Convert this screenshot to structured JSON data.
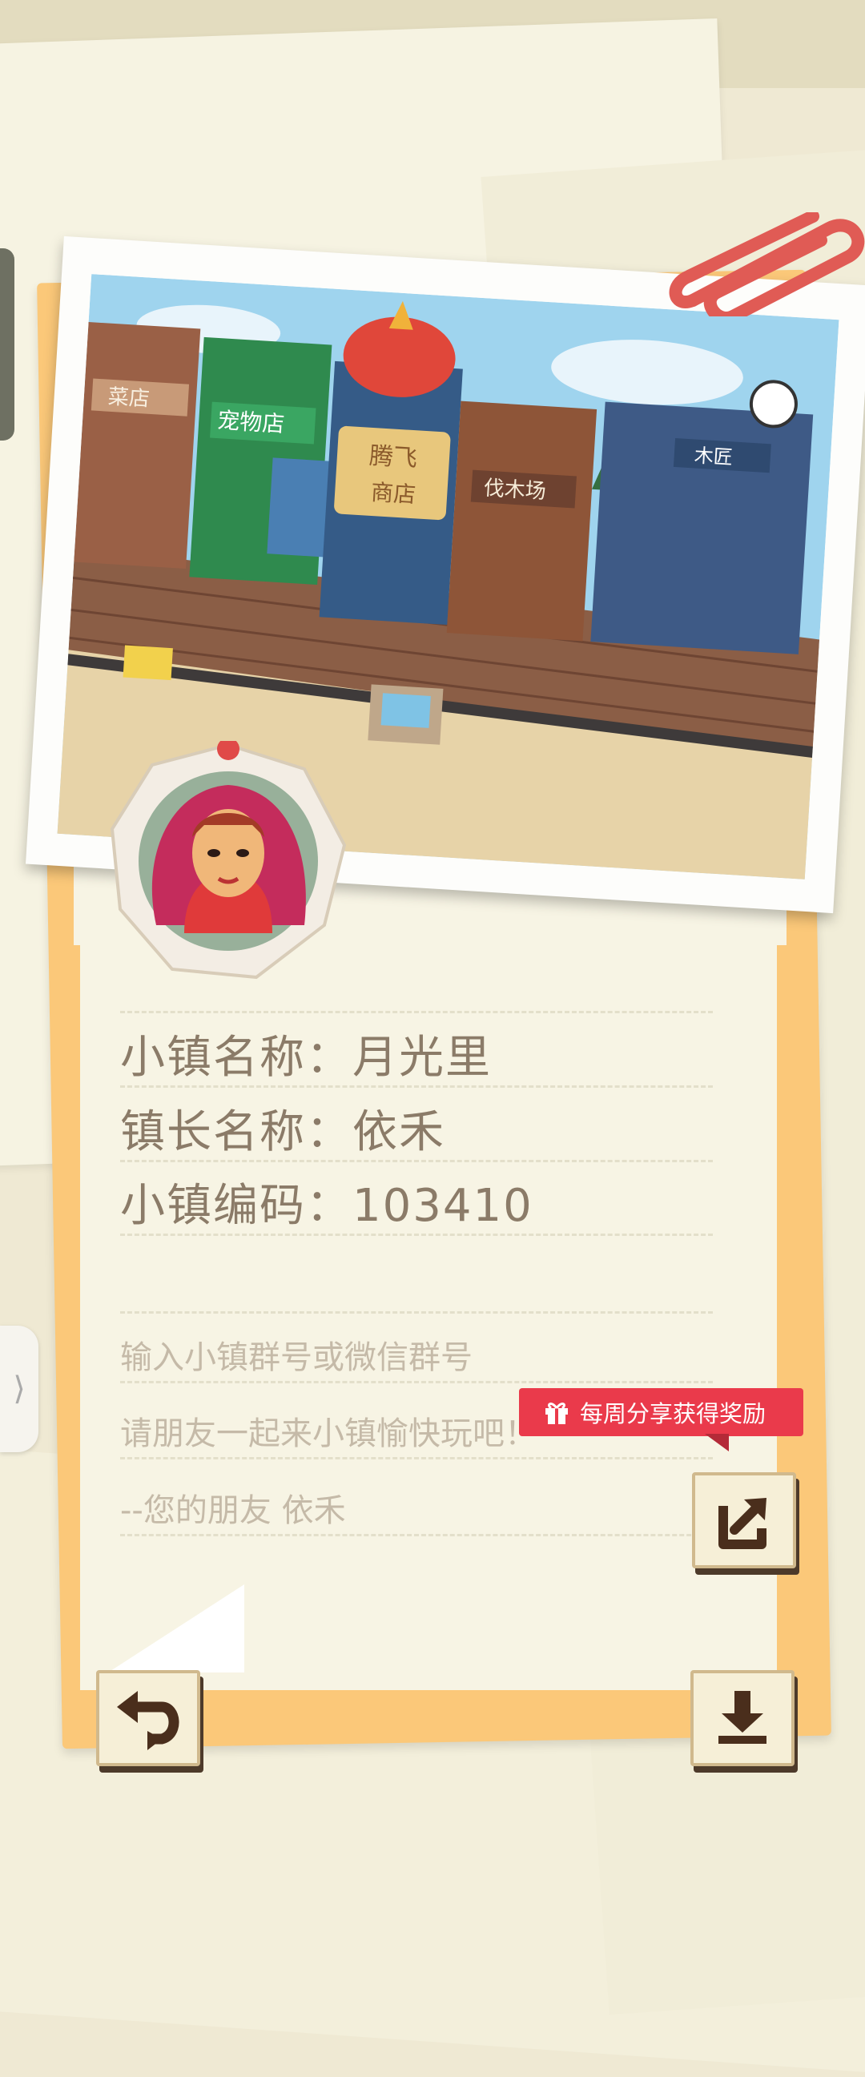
{
  "town": {
    "name_label": "小镇名称：",
    "name_value": "月光里",
    "mayor_label": "镇长名称：",
    "mayor_value": "依禾",
    "code_label": "小镇编码：",
    "code_value": "103410"
  },
  "message": {
    "line1": "输入小镇群号或微信群号",
    "line2": "请朋友一起来小镇愉快玩吧！",
    "line3": "--您的朋友  依禾"
  },
  "banner": {
    "text": "每周分享获得奖励",
    "icon": "gift-icon"
  },
  "photo_signs": {
    "sign1": "菜店",
    "sign2": "宠物店",
    "sign3": "腾飞",
    "sign4": "商店",
    "sign5": "伐木场",
    "sign6": "木匠"
  },
  "buttons": {
    "back": "undo-arrow-icon",
    "share": "share-icon",
    "download": "download-icon"
  },
  "side_tab": {
    "glyph": "⟩"
  },
  "colors": {
    "card": "#fbc879",
    "banner": "#ea3a4b",
    "text": "#8b7b68",
    "paperclip": "#e05b55"
  }
}
